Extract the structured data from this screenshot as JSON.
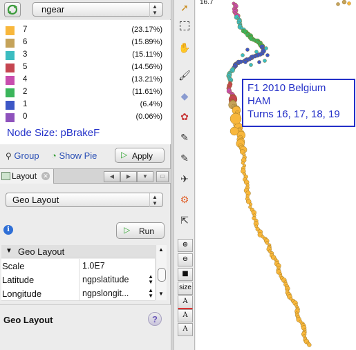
{
  "attribute_selector": {
    "value": "ngear"
  },
  "legend": {
    "items": [
      {
        "label": "7",
        "percent": "(23.17%)",
        "color": "#f8b73c"
      },
      {
        "label": "6",
        "percent": "(15.89%)",
        "color": "#c5a35a"
      },
      {
        "label": "3",
        "percent": "(15.11%)",
        "color": "#3bbcc0"
      },
      {
        "label": "5",
        "percent": "(14.56%)",
        "color": "#c54550"
      },
      {
        "label": "4",
        "percent": "(13.21%)",
        "color": "#c84dae"
      },
      {
        "label": "2",
        "percent": "(11.61%)",
        "color": "#3bb55b"
      },
      {
        "label": "1",
        "percent": "(6.4%)",
        "color": "#3d57c6"
      },
      {
        "label": "0",
        "percent": "(0.06%)",
        "color": "#8e52bc"
      }
    ],
    "node_size": "Node Size: pBrakeF"
  },
  "actions": {
    "group": "Group",
    "show_pie": "Show Pie",
    "apply": "Apply"
  },
  "layout_tab": {
    "label": "Layout"
  },
  "layout_selector": {
    "value": "Geo Layout"
  },
  "run_button": {
    "label": "Run"
  },
  "properties": {
    "section": "Geo Layout",
    "rows": [
      {
        "key": "Scale",
        "value": "1.0E7"
      },
      {
        "key": "Latitude",
        "value": "ngpslatitude"
      },
      {
        "key": "Longitude",
        "value": "ngpslongit..."
      }
    ]
  },
  "help": {
    "title": "Geo Layout",
    "icon": "?"
  },
  "canvas": {
    "coordinate": "16.7",
    "annotation": [
      "F1 2010 Belgium",
      "HAM",
      "Turns 16, 17, 18, 19"
    ]
  },
  "toolbar_icons": [
    "select-arrow-icon",
    "rect-select-icon",
    "lasso-icon",
    "brush-icon",
    "diamond-icon",
    "color-palette-icon",
    "pencil-icon",
    "pencil-alt-icon",
    "airplane-icon",
    "gear-icon",
    "help-pointer-icon",
    "zoom-in-icon",
    "zoom-out-icon",
    "square-icon",
    "size-icon",
    "text-color-icon",
    "text-icon",
    "text-shadow-icon"
  ],
  "toolbar_size_label": "size"
}
